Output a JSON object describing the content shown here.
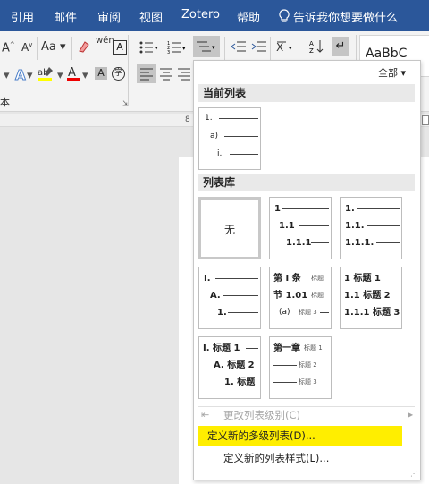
{
  "menu_tabs": [
    "引用",
    "邮件",
    "审阅",
    "视图",
    "Zotero",
    "帮助"
  ],
  "tell_me": "告诉我你想要做什么",
  "ribbon": {
    "font_grow": "A",
    "font_case": "Aa",
    "phonetic": "wén",
    "styles_preview": "AaBbC",
    "paragraph_label": "本",
    "ruler_num": "8"
  },
  "dropdown": {
    "filter": "全部",
    "current_header": "当前列表",
    "library_header": "列表库",
    "none_label": "无",
    "current_list": [
      "1.",
      "a)",
      "i."
    ],
    "tiles": {
      "t2": [
        "1",
        "1.1",
        "1.1.1"
      ],
      "t3": [
        "1.",
        "1.1.",
        "1.1.1."
      ],
      "t4": [
        "I.",
        "A.",
        "1."
      ],
      "t5": [
        "第 I 条",
        "标题",
        "节 1.01",
        "标题",
        "(a)",
        "标题 3"
      ],
      "t6": [
        "1 标题 1",
        "1.1 标题 2",
        "1.1.1 标题 3"
      ],
      "t7": [
        "I. 标题 1",
        "A. 标题 2",
        "1. 标题"
      ],
      "t8": [
        "第一章",
        "标题 1",
        "标题 2",
        "标题 3"
      ]
    },
    "items": {
      "change_level": "更改列表级别(C)",
      "define_multilevel": "定义新的多级列表(D)...",
      "define_style": "定义新的列表样式(L)..."
    },
    "highlight_color": "#ffee00"
  }
}
